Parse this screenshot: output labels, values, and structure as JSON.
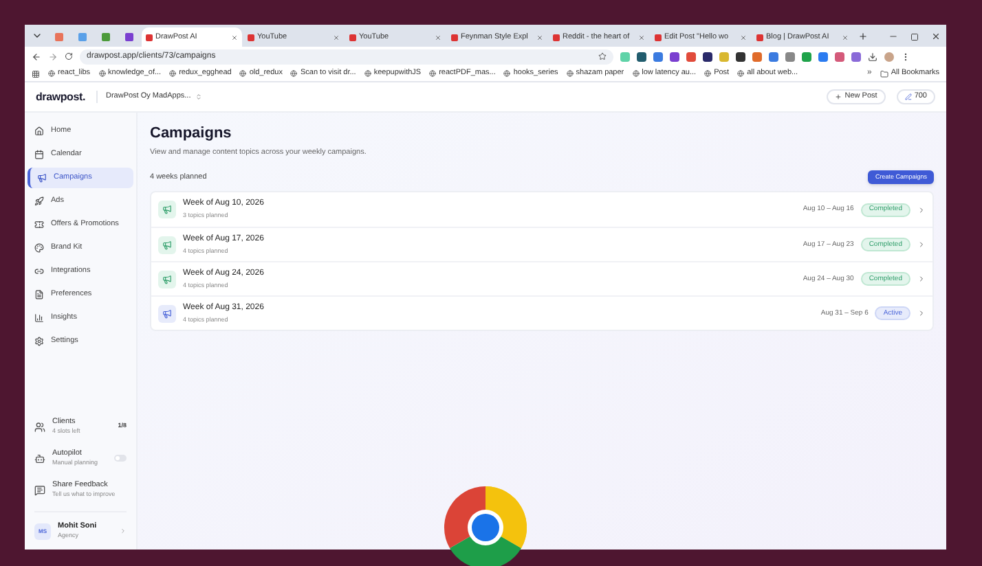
{
  "browser": {
    "tabs": [
      {
        "kind": "pinned",
        "selected": false
      },
      {
        "kind": "pinned",
        "selected": false
      },
      {
        "kind": "pinned",
        "selected": false
      },
      {
        "kind": "pinned",
        "selected": false
      },
      {
        "kind": "page",
        "title": "DrawPost AI",
        "selected": true
      },
      {
        "kind": "page",
        "title": "YouTube",
        "selected": false
      },
      {
        "kind": "page",
        "title": "YouTube",
        "selected": false
      },
      {
        "kind": "page",
        "title": "Feynman Style Expl",
        "selected": false
      },
      {
        "kind": "page",
        "title": "Reddit - the heart of",
        "selected": false
      },
      {
        "kind": "page",
        "title": "Edit Post \"Hello wo",
        "selected": false
      },
      {
        "kind": "page",
        "title": "Blog | DrawPost AI",
        "selected": false
      }
    ],
    "address": "drawpost.app/clients/73/campaigns",
    "bookmarks": [
      "react_libs",
      "knowledge_of...",
      "redux_egghead",
      "old_redux",
      "Scan to visit dr...",
      "keepupwithJS",
      "reactPDF_mas...",
      "hooks_series",
      "shazam paper",
      "low latency au...",
      "Post",
      "all about web..."
    ],
    "bookmarks_more": "»",
    "all_bookmarks": "All Bookmarks"
  },
  "app": {
    "logo": "drawpost.",
    "workspace": "DrawPost Oy MadApps...",
    "new_post": "New Post",
    "credits": "700",
    "nav": [
      {
        "label": "Home",
        "selected": false
      },
      {
        "label": "Calendar",
        "selected": false
      },
      {
        "label": "Campaigns",
        "selected": true
      },
      {
        "label": "Ads",
        "selected": false
      },
      {
        "label": "Offers & Promotions",
        "selected": false
      },
      {
        "label": "Brand Kit",
        "selected": false
      },
      {
        "label": "Integrations",
        "selected": false
      },
      {
        "label": "Preferences",
        "selected": false
      },
      {
        "label": "Insights",
        "selected": false
      },
      {
        "label": "Settings",
        "selected": false
      }
    ],
    "clients": {
      "title": "Clients",
      "subtitle": "4 slots left",
      "count": "1/8"
    },
    "autopilot": {
      "title": "Autopilot",
      "subtitle": "Manual planning",
      "on": false
    },
    "feedback": {
      "title": "Share Feedback",
      "subtitle": "Tell us what to improve"
    },
    "user": {
      "initials": "MS",
      "name": "Mohit Soni",
      "role": "Agency"
    },
    "page": {
      "title": "Campaigns",
      "subtitle": "View and manage content topics across your weekly campaigns.",
      "summary": "4 weeks planned",
      "create_button": "Create Campaigns",
      "weeks": [
        {
          "title": "Week of Aug 10, 2026",
          "topics": "3 topics planned",
          "range": "Aug 10 – Aug 16",
          "status": "Completed",
          "kind": "completed"
        },
        {
          "title": "Week of Aug 17, 2026",
          "topics": "4 topics planned",
          "range": "Aug 17 – Aug 23",
          "status": "Completed",
          "kind": "completed"
        },
        {
          "title": "Week of Aug 24, 2026",
          "topics": "4 topics planned",
          "range": "Aug 24 – Aug 30",
          "status": "Completed",
          "kind": "completed"
        },
        {
          "title": "Week of Aug 31, 2026",
          "topics": "4 topics planned",
          "range": "Aug 31 – Sep 6",
          "status": "Active",
          "kind": "active"
        }
      ]
    }
  }
}
